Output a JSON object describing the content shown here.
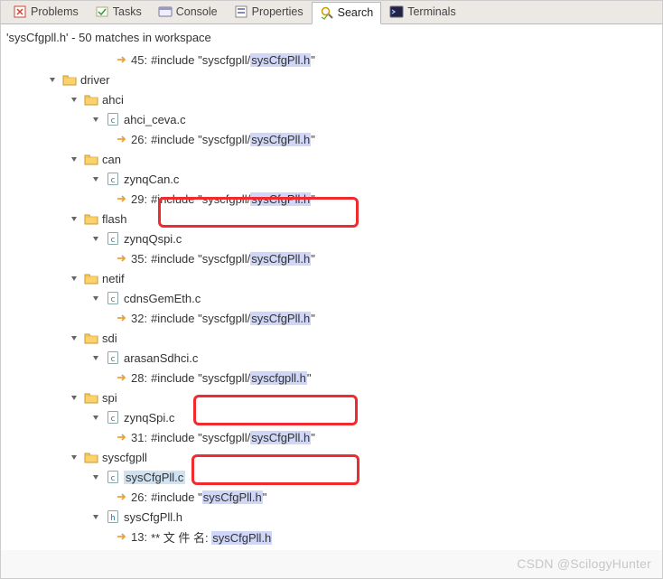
{
  "tabs": {
    "problems": "Problems",
    "tasks": "Tasks",
    "console": "Console",
    "properties": "Properties",
    "search": "Search",
    "terminals": "Terminals"
  },
  "header": "'sysCfgpll.h' - 50 matches in workspace",
  "tree": {
    "match45": {
      "line": "45:",
      "prefix": "#include \"syscfgpll/",
      "hl": "sysCfgPll.h",
      "suffix": "\""
    },
    "driver": {
      "name": "driver"
    },
    "ahci": {
      "name": "ahci"
    },
    "ahci_ceva": {
      "name": "ahci_ceva.c"
    },
    "match26a": {
      "line": "26:",
      "prefix": "#include \"syscfgpll/",
      "hl": "sysCfgPll.h",
      "suffix": "\""
    },
    "can": {
      "name": "can"
    },
    "zynqCan": {
      "name": "zynqCan.c"
    },
    "match29": {
      "line": "29:",
      "prefix": "#include \"syscfgpll/",
      "hl": "sysCfgPll.h",
      "suffix": "\""
    },
    "flash": {
      "name": "flash"
    },
    "zynqQspi": {
      "name": "zynqQspi.c"
    },
    "match35": {
      "line": "35:",
      "prefix": "#include \"syscfgpll/",
      "hl": "sysCfgPll.h",
      "suffix": "\""
    },
    "netif": {
      "name": "netif"
    },
    "cdnsGemEth": {
      "name": "cdnsGemEth.c"
    },
    "match32": {
      "line": "32:",
      "prefix": "#include \"syscfgpll/",
      "hl": "sysCfgPll.h",
      "suffix": "\""
    },
    "sdi": {
      "name": "sdi"
    },
    "arasanSdhci": {
      "name": "arasanSdhci.c"
    },
    "match28": {
      "line": "28:",
      "prefix": "#include \"syscfgpll/",
      "hl": "syscfgpll.h",
      "suffix": "\""
    },
    "spi": {
      "name": "spi"
    },
    "zynqSpi": {
      "name": "zynqSpi.c"
    },
    "match31": {
      "line": "31:",
      "prefix": "#include \"syscfgpll/",
      "hl": "sysCfgPll.h",
      "suffix": "\""
    },
    "syscfgpll": {
      "name": "syscfgpll"
    },
    "sysCfgPll_c": {
      "name": "sysCfgPll.c"
    },
    "match26b": {
      "line": "26:",
      "prefix": "#include \"",
      "hl": "sysCfgPll.h",
      "suffix": "\""
    },
    "sysCfgPll_h": {
      "name": "sysCfgPll.h"
    },
    "match13": {
      "line": "13:",
      "prefix": "** 文   件   名: ",
      "hl": "sysCfgPll.h",
      "suffix": ""
    }
  },
  "watermark": "CSDN @ScilogyHunter"
}
